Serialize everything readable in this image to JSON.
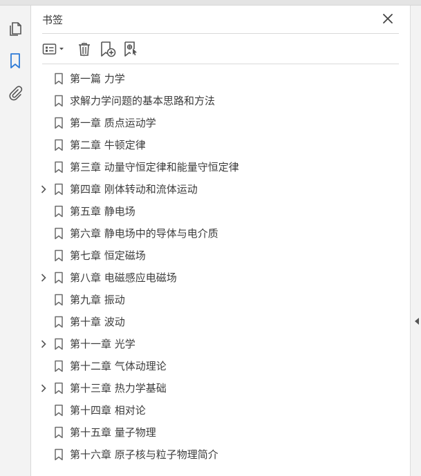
{
  "panel": {
    "title": "书签"
  },
  "sidebar": {
    "icons": [
      "pages-icon",
      "bookmark-icon",
      "attachment-icon"
    ],
    "accent": "#2d7ad6"
  },
  "bookmarks": [
    {
      "label": "第一篇  力学",
      "expandable": false
    },
    {
      "label": "求解力学问题的基本思路和方法",
      "expandable": false
    },
    {
      "label": "第一章  质点运动学",
      "expandable": false
    },
    {
      "label": "第二章  牛顿定律",
      "expandable": false
    },
    {
      "label": "第三章  动量守恒定律和能量守恒定律",
      "expandable": false
    },
    {
      "label": "第四章  刚体转动和流体运动",
      "expandable": true
    },
    {
      "label": "第五章  静电场",
      "expandable": false
    },
    {
      "label": "第六章  静电场中的导体与电介质",
      "expandable": false
    },
    {
      "label": "第七章  恒定磁场",
      "expandable": false
    },
    {
      "label": "第八章  电磁感应电磁场",
      "expandable": true
    },
    {
      "label": "第九章  振动",
      "expandable": false
    },
    {
      "label": "第十章  波动",
      "expandable": false
    },
    {
      "label": "第十一章  光学",
      "expandable": true
    },
    {
      "label": "第十二章  气体动理论",
      "expandable": false
    },
    {
      "label": "第十三章  热力学基础",
      "expandable": true
    },
    {
      "label": "第十四章  相对论",
      "expandable": false
    },
    {
      "label": "第十五章  量子物理",
      "expandable": false
    },
    {
      "label": "第十六章  原子核与粒子物理简介",
      "expandable": false
    }
  ]
}
